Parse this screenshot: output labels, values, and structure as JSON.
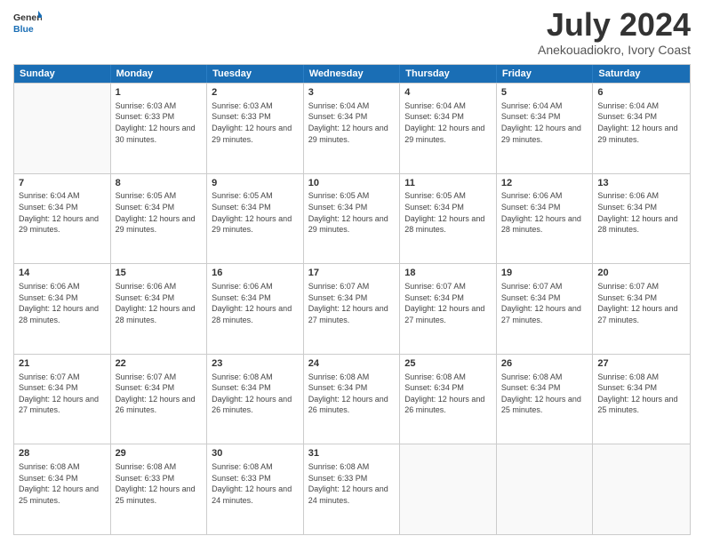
{
  "header": {
    "logo_line1": "General",
    "logo_line2": "Blue",
    "month_title": "July 2024",
    "subtitle": "Anekouadiokro, Ivory Coast"
  },
  "days_of_week": [
    "Sunday",
    "Monday",
    "Tuesday",
    "Wednesday",
    "Thursday",
    "Friday",
    "Saturday"
  ],
  "weeks": [
    [
      {
        "day": "",
        "sunrise": "",
        "sunset": "",
        "daylight": ""
      },
      {
        "day": "1",
        "sunrise": "6:03 AM",
        "sunset": "6:33 PM",
        "daylight": "12 hours and 30 minutes."
      },
      {
        "day": "2",
        "sunrise": "6:03 AM",
        "sunset": "6:33 PM",
        "daylight": "12 hours and 29 minutes."
      },
      {
        "day": "3",
        "sunrise": "6:04 AM",
        "sunset": "6:34 PM",
        "daylight": "12 hours and 29 minutes."
      },
      {
        "day": "4",
        "sunrise": "6:04 AM",
        "sunset": "6:34 PM",
        "daylight": "12 hours and 29 minutes."
      },
      {
        "day": "5",
        "sunrise": "6:04 AM",
        "sunset": "6:34 PM",
        "daylight": "12 hours and 29 minutes."
      },
      {
        "day": "6",
        "sunrise": "6:04 AM",
        "sunset": "6:34 PM",
        "daylight": "12 hours and 29 minutes."
      }
    ],
    [
      {
        "day": "7",
        "sunrise": "6:04 AM",
        "sunset": "6:34 PM",
        "daylight": "12 hours and 29 minutes."
      },
      {
        "day": "8",
        "sunrise": "6:05 AM",
        "sunset": "6:34 PM",
        "daylight": "12 hours and 29 minutes."
      },
      {
        "day": "9",
        "sunrise": "6:05 AM",
        "sunset": "6:34 PM",
        "daylight": "12 hours and 29 minutes."
      },
      {
        "day": "10",
        "sunrise": "6:05 AM",
        "sunset": "6:34 PM",
        "daylight": "12 hours and 29 minutes."
      },
      {
        "day": "11",
        "sunrise": "6:05 AM",
        "sunset": "6:34 PM",
        "daylight": "12 hours and 28 minutes."
      },
      {
        "day": "12",
        "sunrise": "6:06 AM",
        "sunset": "6:34 PM",
        "daylight": "12 hours and 28 minutes."
      },
      {
        "day": "13",
        "sunrise": "6:06 AM",
        "sunset": "6:34 PM",
        "daylight": "12 hours and 28 minutes."
      }
    ],
    [
      {
        "day": "14",
        "sunrise": "6:06 AM",
        "sunset": "6:34 PM",
        "daylight": "12 hours and 28 minutes."
      },
      {
        "day": "15",
        "sunrise": "6:06 AM",
        "sunset": "6:34 PM",
        "daylight": "12 hours and 28 minutes."
      },
      {
        "day": "16",
        "sunrise": "6:06 AM",
        "sunset": "6:34 PM",
        "daylight": "12 hours and 28 minutes."
      },
      {
        "day": "17",
        "sunrise": "6:07 AM",
        "sunset": "6:34 PM",
        "daylight": "12 hours and 27 minutes."
      },
      {
        "day": "18",
        "sunrise": "6:07 AM",
        "sunset": "6:34 PM",
        "daylight": "12 hours and 27 minutes."
      },
      {
        "day": "19",
        "sunrise": "6:07 AM",
        "sunset": "6:34 PM",
        "daylight": "12 hours and 27 minutes."
      },
      {
        "day": "20",
        "sunrise": "6:07 AM",
        "sunset": "6:34 PM",
        "daylight": "12 hours and 27 minutes."
      }
    ],
    [
      {
        "day": "21",
        "sunrise": "6:07 AM",
        "sunset": "6:34 PM",
        "daylight": "12 hours and 27 minutes."
      },
      {
        "day": "22",
        "sunrise": "6:07 AM",
        "sunset": "6:34 PM",
        "daylight": "12 hours and 26 minutes."
      },
      {
        "day": "23",
        "sunrise": "6:08 AM",
        "sunset": "6:34 PM",
        "daylight": "12 hours and 26 minutes."
      },
      {
        "day": "24",
        "sunrise": "6:08 AM",
        "sunset": "6:34 PM",
        "daylight": "12 hours and 26 minutes."
      },
      {
        "day": "25",
        "sunrise": "6:08 AM",
        "sunset": "6:34 PM",
        "daylight": "12 hours and 26 minutes."
      },
      {
        "day": "26",
        "sunrise": "6:08 AM",
        "sunset": "6:34 PM",
        "daylight": "12 hours and 25 minutes."
      },
      {
        "day": "27",
        "sunrise": "6:08 AM",
        "sunset": "6:34 PM",
        "daylight": "12 hours and 25 minutes."
      }
    ],
    [
      {
        "day": "28",
        "sunrise": "6:08 AM",
        "sunset": "6:34 PM",
        "daylight": "12 hours and 25 minutes."
      },
      {
        "day": "29",
        "sunrise": "6:08 AM",
        "sunset": "6:33 PM",
        "daylight": "12 hours and 25 minutes."
      },
      {
        "day": "30",
        "sunrise": "6:08 AM",
        "sunset": "6:33 PM",
        "daylight": "12 hours and 24 minutes."
      },
      {
        "day": "31",
        "sunrise": "6:08 AM",
        "sunset": "6:33 PM",
        "daylight": "12 hours and 24 minutes."
      },
      {
        "day": "",
        "sunrise": "",
        "sunset": "",
        "daylight": ""
      },
      {
        "day": "",
        "sunrise": "",
        "sunset": "",
        "daylight": ""
      },
      {
        "day": "",
        "sunrise": "",
        "sunset": "",
        "daylight": ""
      }
    ]
  ]
}
